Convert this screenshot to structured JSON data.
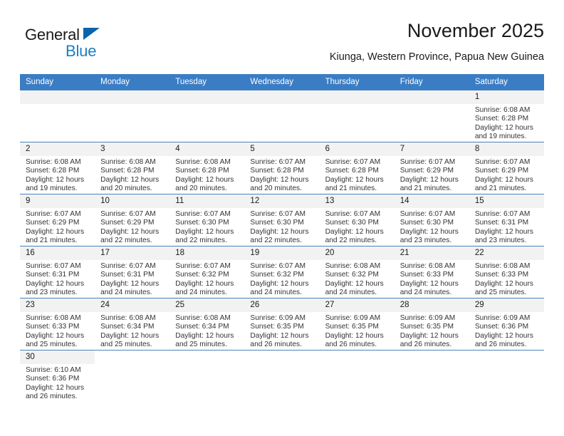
{
  "brand": {
    "name_part1": "General",
    "name_part2": "Blue",
    "accent_color": "#1d7ec4",
    "triangle_color": "#0b63ad"
  },
  "header": {
    "title": "November 2025",
    "subtitle": "Kiunga, Western Province, Papua New Guinea"
  },
  "calendar": {
    "header_bg": "#3a7dc4",
    "daynum_bg": "#f2f2f2",
    "weekday_headers": [
      "Sunday",
      "Monday",
      "Tuesday",
      "Wednesday",
      "Thursday",
      "Friday",
      "Saturday"
    ],
    "weeks": [
      [
        {
          "blank": true
        },
        {
          "blank": true
        },
        {
          "blank": true
        },
        {
          "blank": true
        },
        {
          "blank": true
        },
        {
          "blank": true
        },
        {
          "day": "1",
          "sunrise": "Sunrise: 6:08 AM",
          "sunset": "Sunset: 6:28 PM",
          "daylight1": "Daylight: 12 hours",
          "daylight2": "and 19 minutes."
        }
      ],
      [
        {
          "day": "2",
          "sunrise": "Sunrise: 6:08 AM",
          "sunset": "Sunset: 6:28 PM",
          "daylight1": "Daylight: 12 hours",
          "daylight2": "and 19 minutes."
        },
        {
          "day": "3",
          "sunrise": "Sunrise: 6:08 AM",
          "sunset": "Sunset: 6:28 PM",
          "daylight1": "Daylight: 12 hours",
          "daylight2": "and 20 minutes."
        },
        {
          "day": "4",
          "sunrise": "Sunrise: 6:08 AM",
          "sunset": "Sunset: 6:28 PM",
          "daylight1": "Daylight: 12 hours",
          "daylight2": "and 20 minutes."
        },
        {
          "day": "5",
          "sunrise": "Sunrise: 6:07 AM",
          "sunset": "Sunset: 6:28 PM",
          "daylight1": "Daylight: 12 hours",
          "daylight2": "and 20 minutes."
        },
        {
          "day": "6",
          "sunrise": "Sunrise: 6:07 AM",
          "sunset": "Sunset: 6:28 PM",
          "daylight1": "Daylight: 12 hours",
          "daylight2": "and 21 minutes."
        },
        {
          "day": "7",
          "sunrise": "Sunrise: 6:07 AM",
          "sunset": "Sunset: 6:29 PM",
          "daylight1": "Daylight: 12 hours",
          "daylight2": "and 21 minutes."
        },
        {
          "day": "8",
          "sunrise": "Sunrise: 6:07 AM",
          "sunset": "Sunset: 6:29 PM",
          "daylight1": "Daylight: 12 hours",
          "daylight2": "and 21 minutes."
        }
      ],
      [
        {
          "day": "9",
          "sunrise": "Sunrise: 6:07 AM",
          "sunset": "Sunset: 6:29 PM",
          "daylight1": "Daylight: 12 hours",
          "daylight2": "and 21 minutes."
        },
        {
          "day": "10",
          "sunrise": "Sunrise: 6:07 AM",
          "sunset": "Sunset: 6:29 PM",
          "daylight1": "Daylight: 12 hours",
          "daylight2": "and 22 minutes."
        },
        {
          "day": "11",
          "sunrise": "Sunrise: 6:07 AM",
          "sunset": "Sunset: 6:30 PM",
          "daylight1": "Daylight: 12 hours",
          "daylight2": "and 22 minutes."
        },
        {
          "day": "12",
          "sunrise": "Sunrise: 6:07 AM",
          "sunset": "Sunset: 6:30 PM",
          "daylight1": "Daylight: 12 hours",
          "daylight2": "and 22 minutes."
        },
        {
          "day": "13",
          "sunrise": "Sunrise: 6:07 AM",
          "sunset": "Sunset: 6:30 PM",
          "daylight1": "Daylight: 12 hours",
          "daylight2": "and 22 minutes."
        },
        {
          "day": "14",
          "sunrise": "Sunrise: 6:07 AM",
          "sunset": "Sunset: 6:30 PM",
          "daylight1": "Daylight: 12 hours",
          "daylight2": "and 23 minutes."
        },
        {
          "day": "15",
          "sunrise": "Sunrise: 6:07 AM",
          "sunset": "Sunset: 6:31 PM",
          "daylight1": "Daylight: 12 hours",
          "daylight2": "and 23 minutes."
        }
      ],
      [
        {
          "day": "16",
          "sunrise": "Sunrise: 6:07 AM",
          "sunset": "Sunset: 6:31 PM",
          "daylight1": "Daylight: 12 hours",
          "daylight2": "and 23 minutes."
        },
        {
          "day": "17",
          "sunrise": "Sunrise: 6:07 AM",
          "sunset": "Sunset: 6:31 PM",
          "daylight1": "Daylight: 12 hours",
          "daylight2": "and 24 minutes."
        },
        {
          "day": "18",
          "sunrise": "Sunrise: 6:07 AM",
          "sunset": "Sunset: 6:32 PM",
          "daylight1": "Daylight: 12 hours",
          "daylight2": "and 24 minutes."
        },
        {
          "day": "19",
          "sunrise": "Sunrise: 6:07 AM",
          "sunset": "Sunset: 6:32 PM",
          "daylight1": "Daylight: 12 hours",
          "daylight2": "and 24 minutes."
        },
        {
          "day": "20",
          "sunrise": "Sunrise: 6:08 AM",
          "sunset": "Sunset: 6:32 PM",
          "daylight1": "Daylight: 12 hours",
          "daylight2": "and 24 minutes."
        },
        {
          "day": "21",
          "sunrise": "Sunrise: 6:08 AM",
          "sunset": "Sunset: 6:33 PM",
          "daylight1": "Daylight: 12 hours",
          "daylight2": "and 24 minutes."
        },
        {
          "day": "22",
          "sunrise": "Sunrise: 6:08 AM",
          "sunset": "Sunset: 6:33 PM",
          "daylight1": "Daylight: 12 hours",
          "daylight2": "and 25 minutes."
        }
      ],
      [
        {
          "day": "23",
          "sunrise": "Sunrise: 6:08 AM",
          "sunset": "Sunset: 6:33 PM",
          "daylight1": "Daylight: 12 hours",
          "daylight2": "and 25 minutes."
        },
        {
          "day": "24",
          "sunrise": "Sunrise: 6:08 AM",
          "sunset": "Sunset: 6:34 PM",
          "daylight1": "Daylight: 12 hours",
          "daylight2": "and 25 minutes."
        },
        {
          "day": "25",
          "sunrise": "Sunrise: 6:08 AM",
          "sunset": "Sunset: 6:34 PM",
          "daylight1": "Daylight: 12 hours",
          "daylight2": "and 25 minutes."
        },
        {
          "day": "26",
          "sunrise": "Sunrise: 6:09 AM",
          "sunset": "Sunset: 6:35 PM",
          "daylight1": "Daylight: 12 hours",
          "daylight2": "and 26 minutes."
        },
        {
          "day": "27",
          "sunrise": "Sunrise: 6:09 AM",
          "sunset": "Sunset: 6:35 PM",
          "daylight1": "Daylight: 12 hours",
          "daylight2": "and 26 minutes."
        },
        {
          "day": "28",
          "sunrise": "Sunrise: 6:09 AM",
          "sunset": "Sunset: 6:35 PM",
          "daylight1": "Daylight: 12 hours",
          "daylight2": "and 26 minutes."
        },
        {
          "day": "29",
          "sunrise": "Sunrise: 6:09 AM",
          "sunset": "Sunset: 6:36 PM",
          "daylight1": "Daylight: 12 hours",
          "daylight2": "and 26 minutes."
        }
      ],
      [
        {
          "day": "30",
          "sunrise": "Sunrise: 6:10 AM",
          "sunset": "Sunset: 6:36 PM",
          "daylight1": "Daylight: 12 hours",
          "daylight2": "and 26 minutes."
        },
        {
          "blank": true,
          "tail": true
        },
        {
          "blank": true,
          "tail": true
        },
        {
          "blank": true,
          "tail": true
        },
        {
          "blank": true,
          "tail": true
        },
        {
          "blank": true,
          "tail": true
        },
        {
          "blank": true,
          "tail": true
        }
      ]
    ]
  }
}
